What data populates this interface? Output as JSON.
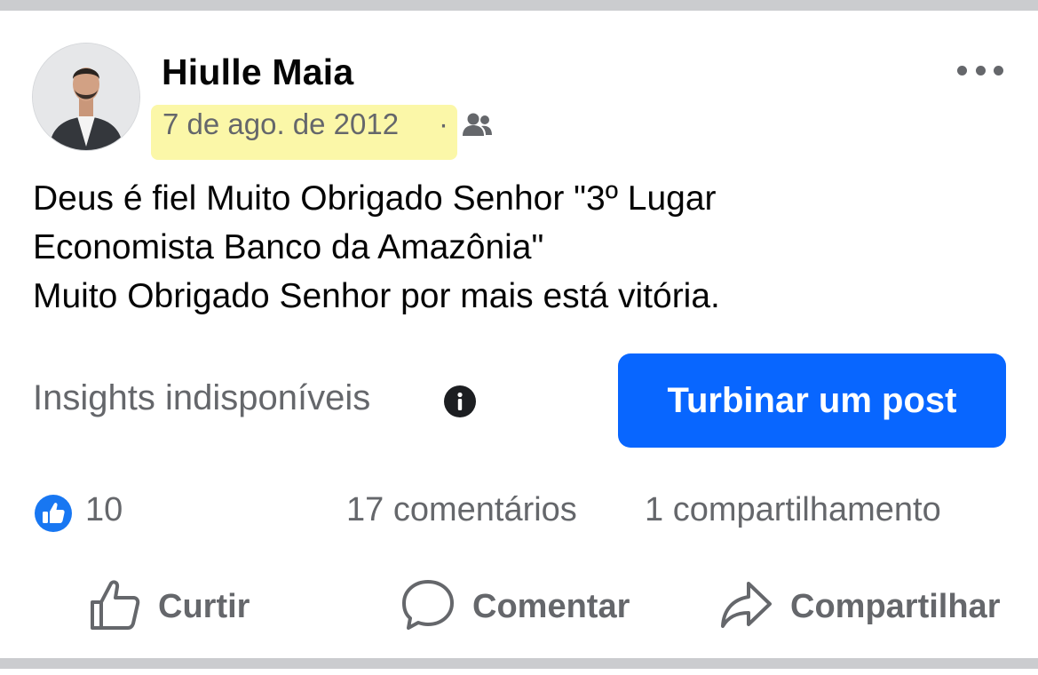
{
  "post": {
    "author_name": "Hiulle Maia",
    "date": "7 de ago. de 2012",
    "separator": "·",
    "audience_icon": "friends-icon",
    "body_lines": [
      "Deus é fiel Muito Obrigado Senhor \"3º Lugar",
      "Economista Banco da Amazônia\"",
      "Muito Obrigado Senhor por mais está vitória."
    ]
  },
  "insights": {
    "label": "Insights indisponíveis",
    "icon": "info-icon",
    "boost_label": "Turbinar um post"
  },
  "engagement": {
    "reaction_icon": "like-reaction-icon",
    "likes": "10",
    "comments": "17 comentários",
    "shares": "1 compartilhamento"
  },
  "actions": {
    "like_label": "Curtir",
    "comment_label": "Comentar",
    "share_label": "Compartilhar"
  },
  "colors": {
    "accent": "#0866ff",
    "secondary_text": "#65676b",
    "highlight": "#fbf7a8",
    "divider": "#cbcccf"
  }
}
